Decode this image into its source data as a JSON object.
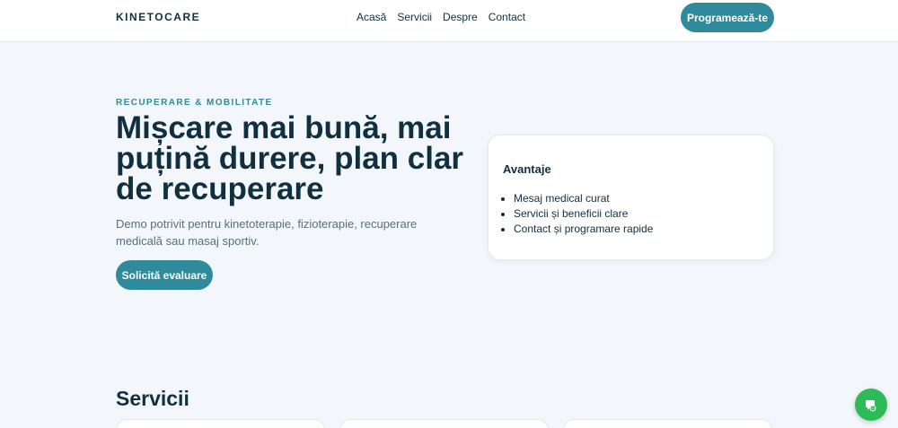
{
  "header": {
    "brand": "KINETOCARE",
    "nav": [
      "Acasă",
      "Servicii",
      "Despre",
      "Contact"
    ],
    "cta": "Programează-te"
  },
  "hero": {
    "eyebrow": "RECUPERARE & MOBILITATE",
    "title_lines": [
      "Mișcare mai bună, mai",
      "puțină durere, plan clar",
      "de recuperare"
    ],
    "description": "Demo potrivit pentru kinetoterapie, fizioterapie, recuperare medicală sau masaj sportiv.",
    "cta": "Solicită evaluare"
  },
  "advantages": {
    "title": "Avantaje",
    "items": [
      "Mesaj medical curat",
      "Servicii și beneficii clare",
      "Contact și programare rapide"
    ]
  },
  "services": {
    "title": "Servicii"
  },
  "colors": {
    "accent": "#2f8b9b",
    "dark": "#10303f",
    "chat": "#2dbb58"
  },
  "icons": {
    "chat": "whatsapp-chat-icon"
  }
}
